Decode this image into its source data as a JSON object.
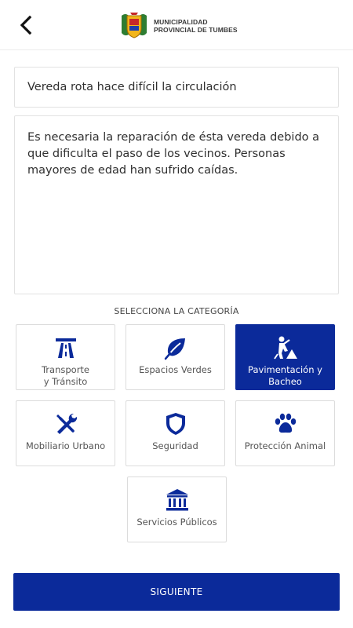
{
  "header": {
    "logo_line1": "MUNICIPALIDAD",
    "logo_line2": "PROVINCIAL DE TUMBES"
  },
  "form": {
    "title_value": "Vereda rota hace difícil la circulación",
    "description_value": "Es necesaria la reparación de ésta vereda debido a que dificulta el paso de los vecinos. Personas mayores de edad han sufrido caídas."
  },
  "category_section": {
    "label": "SELECCIONA LA CATEGORÍA",
    "selected": "Pavimentación y Bacheo",
    "items": [
      {
        "line1": "Transporte",
        "line2": "y Tránsito",
        "icon": "road-icon"
      },
      {
        "line1": "Espacios Verdes",
        "line2": "",
        "icon": "leaf-icon"
      },
      {
        "line1": "Pavimentación y",
        "line2": "Bacheo",
        "icon": "road-worker-icon"
      },
      {
        "line1": "Mobiliario Urbano",
        "line2": "",
        "icon": "tools-icon"
      },
      {
        "line1": "Seguridad",
        "line2": "",
        "icon": "shield-icon"
      },
      {
        "line1": "Protección Animal",
        "line2": "",
        "icon": "paw-icon"
      },
      {
        "line1": "Servicios Públicos",
        "line2": "",
        "icon": "building-columns-icon"
      }
    ]
  },
  "next_button": {
    "label": "SIGUIENTE"
  },
  "colors": {
    "primary": "#0b2a9a",
    "border": "#dcdcdc"
  }
}
